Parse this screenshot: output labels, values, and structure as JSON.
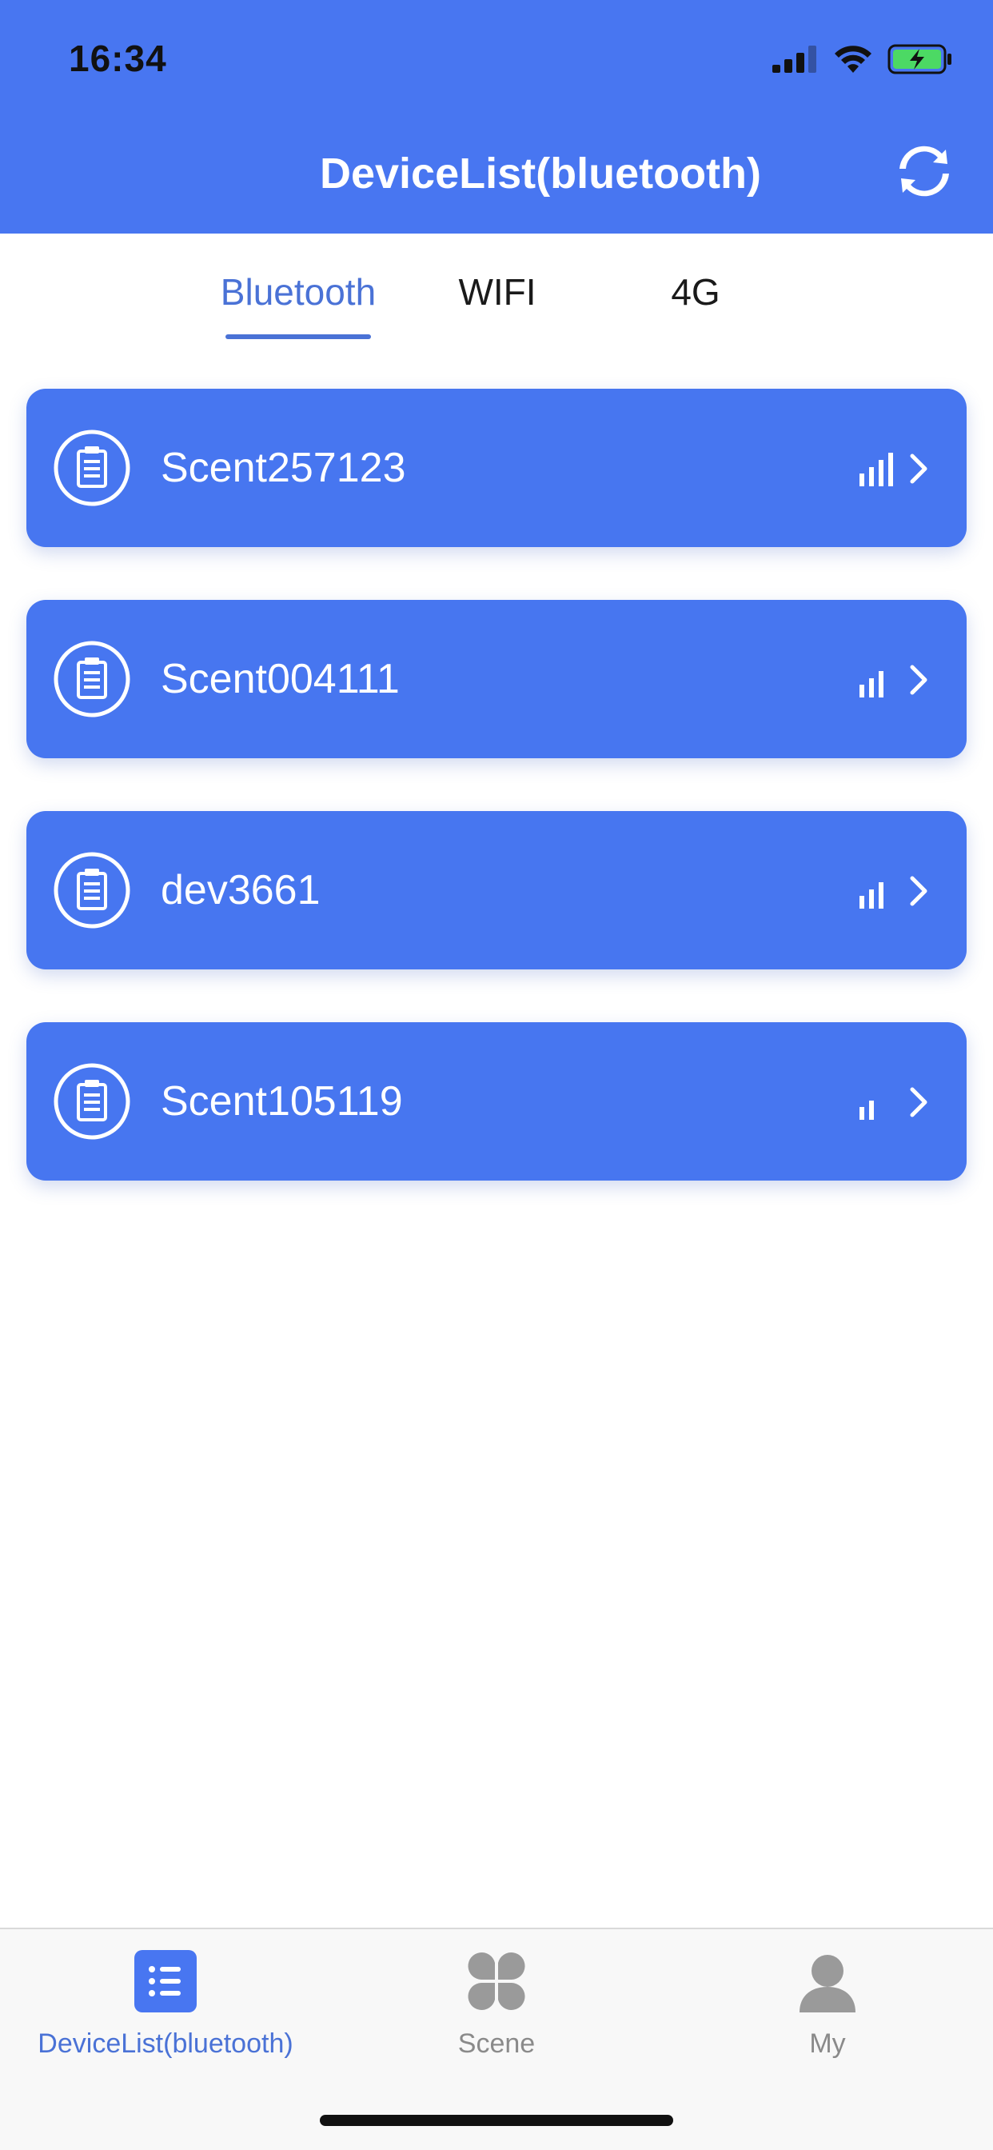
{
  "status_bar": {
    "time": "16:34"
  },
  "header": {
    "title": "DeviceList(bluetooth)"
  },
  "tabs": [
    {
      "label": "Bluetooth",
      "active": true
    },
    {
      "label": "WIFI",
      "active": false
    },
    {
      "label": "4G",
      "active": false
    }
  ],
  "devices": [
    {
      "name": "Scent257123",
      "signal_bars": 4
    },
    {
      "name": "Scent004111",
      "signal_bars": 3
    },
    {
      "name": "dev3661",
      "signal_bars": 3
    },
    {
      "name": "Scent105119",
      "signal_bars": 2
    }
  ],
  "bottom_nav": [
    {
      "label": "DeviceList(bluetooth)",
      "icon": "list-icon",
      "active": true
    },
    {
      "label": "Scene",
      "icon": "clover-icon",
      "active": false
    },
    {
      "label": "My",
      "icon": "person-icon",
      "active": false
    }
  ],
  "colors": {
    "accent": "#4876f1",
    "active_text": "#4a72d6",
    "inactive_nav": "#8a8a8a"
  }
}
